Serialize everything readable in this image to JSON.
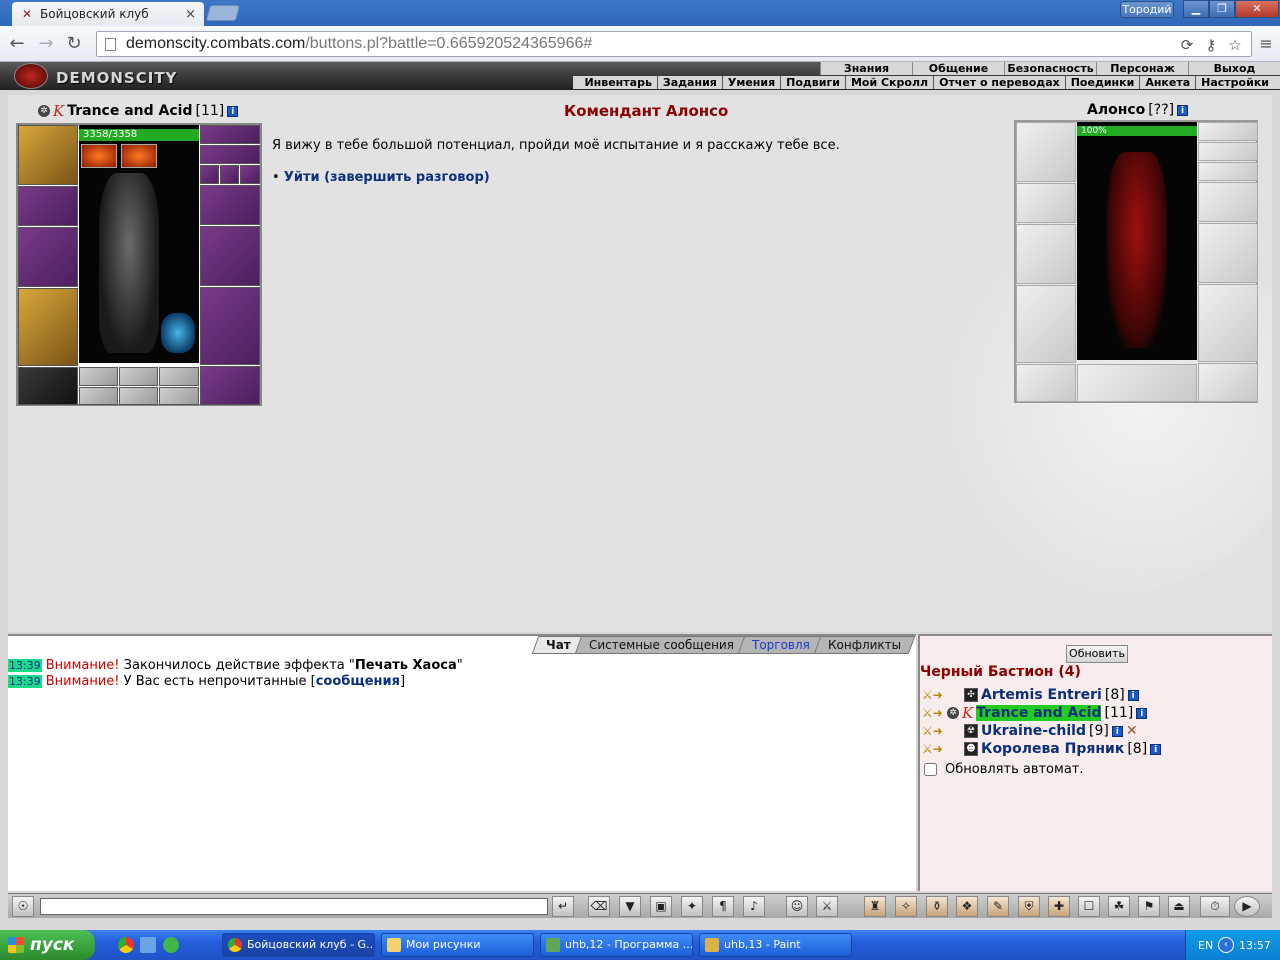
{
  "browser": {
    "tab_title": "Бойцовский клуб",
    "user_badge": "Тородий",
    "url_host": "demonscity.combats.com",
    "url_path": "/buttons.pl?battle=0.665920524365966#"
  },
  "game": {
    "logo": "DEMONSCITY",
    "top_nav": [
      "Знания",
      "Общение",
      "Безопасность",
      "Персонаж",
      "Выход"
    ],
    "sub_nav": [
      "Инвентарь",
      "Задания",
      "Умения",
      "Подвиги",
      "Мой Скролл",
      "Отчет о переводах",
      "Поединки",
      "Анкета",
      "Настройки"
    ]
  },
  "player": {
    "name": "Trance and Acid",
    "level": "[11]",
    "hp": "3358/3358"
  },
  "npc": {
    "title": "Комендант Алонсо",
    "name": "Алонсо",
    "level": "[??]",
    "hp": "100%",
    "text": "Я вижу в тебе большой потенциал, пройди моё испытание и я расскажу тебе все.",
    "option_bullet": "•",
    "option": "Уйти (завершить разговор)"
  },
  "chat": {
    "tabs": [
      {
        "label": "Чат",
        "active": true
      },
      {
        "label": "Системные сообщения",
        "active": false
      },
      {
        "label": "Торговля",
        "active": false
      },
      {
        "label": "Конфликты",
        "active": false
      }
    ],
    "lines": [
      {
        "time": "13:39",
        "warn": "Внимание!",
        "text": " Закончилось действие эффекта \"",
        "bold": "Печать Хаоса",
        "tail": "\""
      },
      {
        "time": "13:39",
        "warn": "Внимание!",
        "text": " У Вас есть непрочитанные [",
        "link": "сообщения",
        "tail": "]"
      }
    ]
  },
  "online": {
    "refresh_label": "Обновить",
    "room": "Черный Бастион (4)",
    "players": [
      {
        "name": "Artemis Entreri",
        "level": "[8]"
      },
      {
        "name": "Trance and Acid",
        "level": "[11]"
      },
      {
        "name": "Ukraine-child",
        "level": "[9]"
      },
      {
        "name": "Королева Пряник",
        "level": "[8]"
      }
    ],
    "auto_refresh_label": "Обновлять автомат."
  },
  "taskbar": {
    "start": "пуск",
    "tasks": [
      "Бойцовский клуб - G...",
      "Мои рисунки",
      "uhb,12 - Программа ...",
      "uhb,13 - Paint"
    ],
    "lang": "EN",
    "clock": "13:57"
  }
}
